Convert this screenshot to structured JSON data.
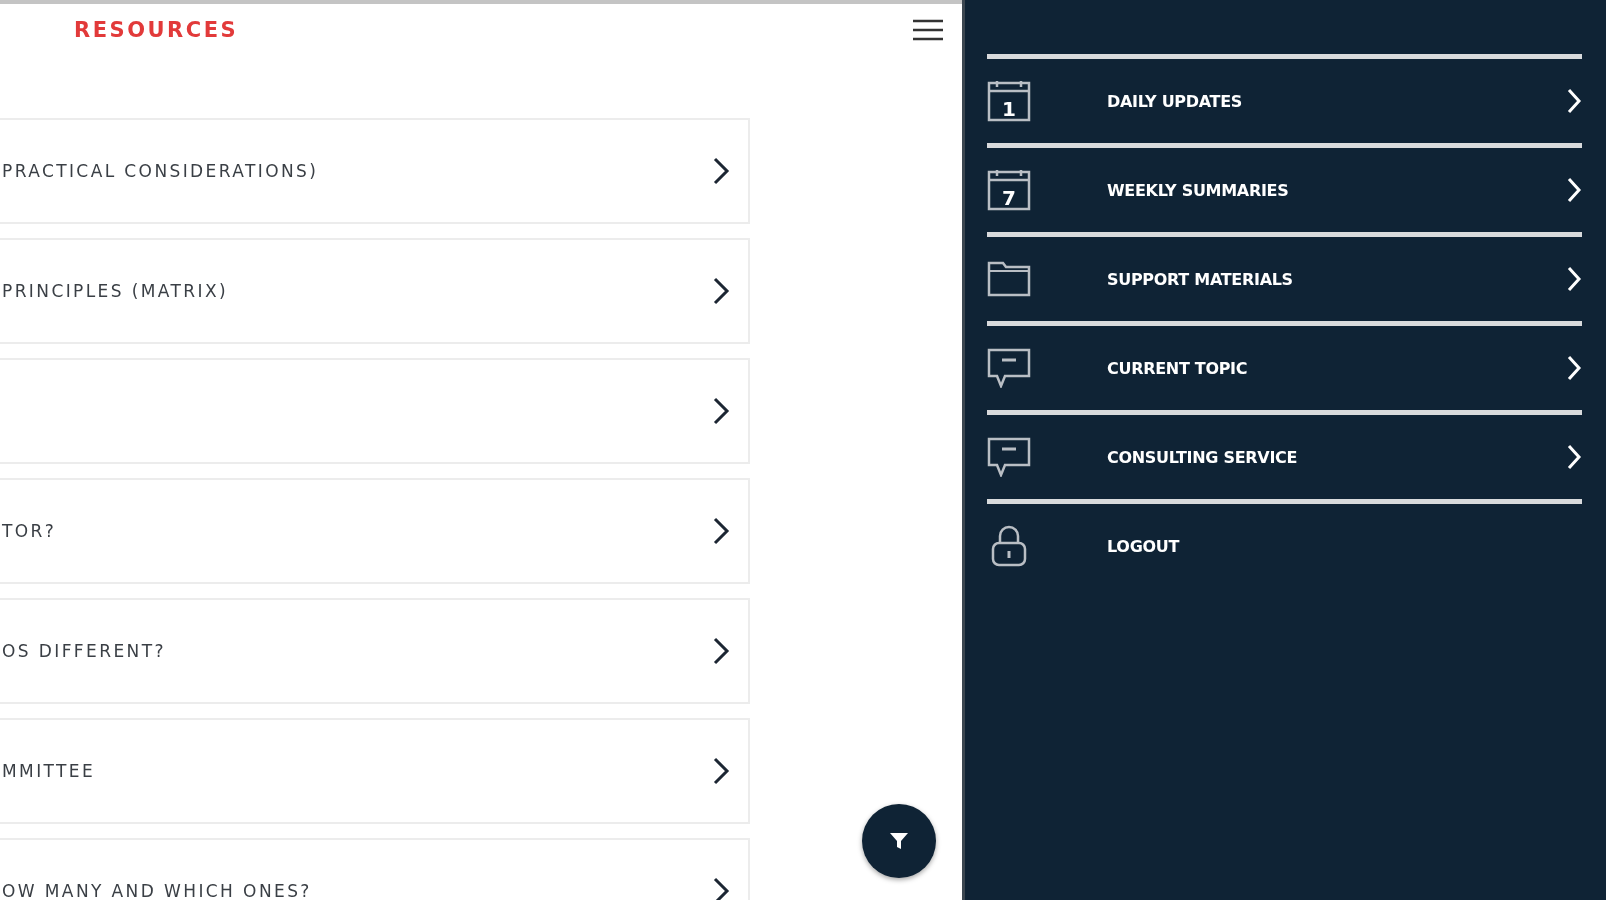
{
  "header": {
    "title": "RESOURCES"
  },
  "cards": [
    {
      "kind": "text",
      "label": "PRACTICAL CONSIDERATIONS)"
    },
    {
      "kind": "text",
      "label": "PRINCIPLES (MATRIX)"
    },
    {
      "kind": "blank"
    },
    {
      "kind": "text",
      "label": "TOR?"
    },
    {
      "kind": "text",
      "label": "OS DIFFERENT?"
    },
    {
      "kind": "text",
      "label": "MMITTEE"
    },
    {
      "kind": "text",
      "label": "OW MANY AND WHICH ONES?"
    }
  ],
  "menu": [
    {
      "kind": "calendar",
      "icon_label": "1",
      "label": "DAILY UPDATES",
      "arrow": true
    },
    {
      "kind": "calendar",
      "icon_label": "7",
      "label": "WEEKLY SUMMARIES",
      "arrow": true
    },
    {
      "kind": "folder",
      "label": "SUPPORT MATERIALS",
      "arrow": true
    },
    {
      "kind": "chat",
      "label": "CURRENT TOPIC",
      "arrow": true
    },
    {
      "kind": "chat",
      "label": "CONSULTING SERVICE",
      "arrow": true
    },
    {
      "kind": "lock",
      "label": "LOGOUT",
      "arrow": false
    }
  ]
}
